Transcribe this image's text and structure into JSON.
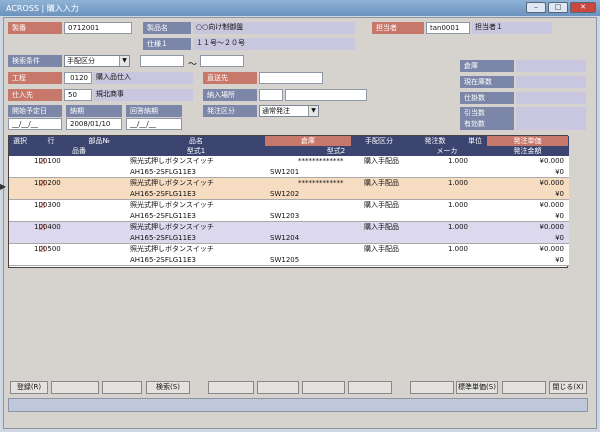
{
  "window": {
    "title": "ACROSS | 購入入力"
  },
  "header": {
    "seiban_label": "製番",
    "seiban_value": "0712001",
    "seihinmei_label": "製品名",
    "seihinmei_value": "○○向け制御盤",
    "shiyou_label": "仕様１",
    "shiyou_value": "１１号〜２０号",
    "tantou_label": "担当者",
    "tantou_code": "tan0001",
    "tantou_name": "担当者１",
    "search_label": "検索条件",
    "search_value": "手配区分",
    "tilde": "〜",
    "koutei_label": "工程",
    "koutei_code": "0120",
    "koutei_name": "購入品仕入",
    "shiiresaki_label": "仕入先",
    "shiiresaki_code": "50",
    "shiiresaki_name": "規北商事",
    "chokusou_label": "直送先",
    "nounyu_label": "納入場所",
    "hatchu_label": "発注区分",
    "hatchu_value": "通常発注",
    "kaishi_label": "開始予定日",
    "kaishi_value": "__/__/__",
    "nouki_label": "納期",
    "nouki_value": "2008/01/10",
    "kaitou_label": "回答納期",
    "kaitou_value": "__/__/__",
    "soko_label": "倉庫",
    "zaiko_label": "現在庫数",
    "shikake_label": "仕掛数",
    "hikiate_label": "引当数",
    "yuko_label": "有効数"
  },
  "grid": {
    "headers1": [
      "選択",
      "行",
      "部品№",
      "品名",
      "倉庫",
      "手配区分",
      "発注数",
      "単位",
      "発注単価"
    ],
    "headers2": [
      "品番",
      "型式1",
      "型式2",
      "メーカ",
      "発注金額"
    ],
    "rows": [
      {
        "gyo": "100100",
        "hinmei": "照光式押しボタンスイッチ",
        "katashiki1": "AH165-2SFLG11E3",
        "katashiki2": "SW1201",
        "soko": "*************",
        "tehai": "購入手配品",
        "suryo": "1.000",
        "tanka": "¥0.000",
        "kingaku": "¥0"
      },
      {
        "gyo": "100200",
        "hinmei": "照光式押しボタンスイッチ",
        "katashiki1": "AH165-2SFLG11E3",
        "katashiki2": "SW1202",
        "soko": "*************",
        "tehai": "購入手配品",
        "suryo": "1.000",
        "tanka": "¥0.000",
        "kingaku": "¥0"
      },
      {
        "gyo": "100300",
        "hinmei": "照光式押しボタンスイッチ",
        "katashiki1": "AH165-2SFLG11E3",
        "katashiki2": "SW1203",
        "soko": "",
        "tehai": "購入手配品",
        "suryo": "1.000",
        "tanka": "¥0.000",
        "kingaku": "¥0"
      },
      {
        "gyo": "100400",
        "hinmei": "照光式押しボタンスイッチ",
        "katashiki1": "AH165-2SFLG11E3",
        "katashiki2": "SW1204",
        "soko": "",
        "tehai": "購入手配品",
        "suryo": "1.000",
        "tanka": "¥0.000",
        "kingaku": "¥0"
      },
      {
        "gyo": "100500",
        "hinmei": "照光式押しボタンスイッチ",
        "katashiki1": "AH165-2SFLG11E3",
        "katashiki2": "SW1205",
        "soko": "",
        "tehai": "購入手配品",
        "suryo": "1.000",
        "tanka": "¥0.000",
        "kingaku": "¥0"
      }
    ]
  },
  "buttons": {
    "toroku": "登録(R)",
    "kensaku": "検索(S)",
    "hyojun": "標準単価(S)",
    "tojiru": "閉じる(X)"
  },
  "colors": {
    "selected_row": "#f6dcc0",
    "even_row": "#dcd9ee",
    "header_dark": "#3c4470",
    "header_red": "#c8786a"
  }
}
